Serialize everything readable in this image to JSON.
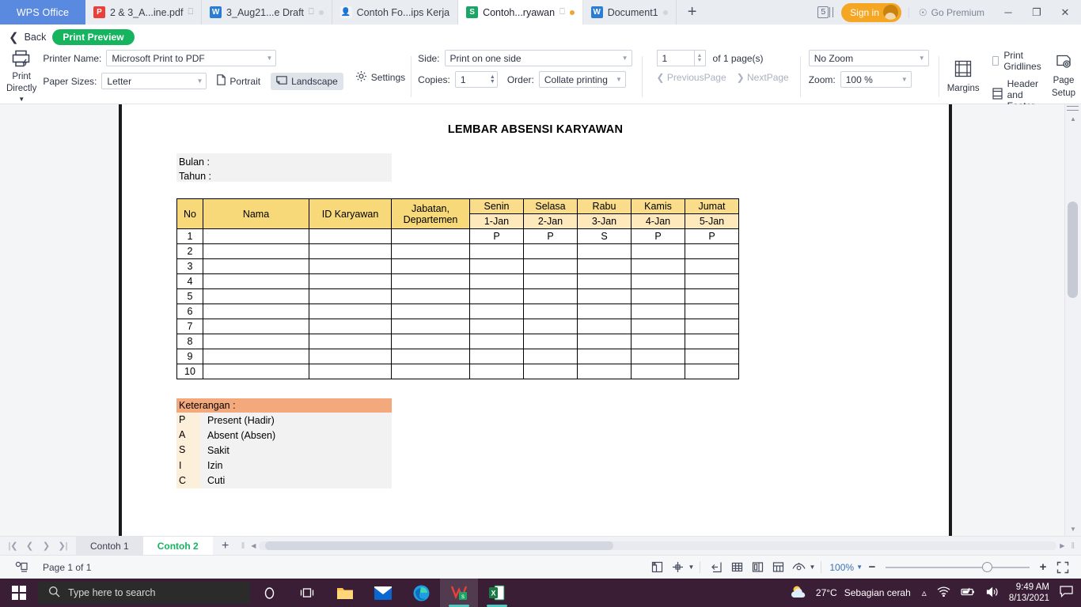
{
  "window": {
    "brand": "WPS Office",
    "tabs": [
      {
        "label": "2 & 3_A...ine.pdf",
        "icon": "pdf-icon",
        "active": false,
        "monitor": true,
        "dot": ""
      },
      {
        "label": "3_Aug21...e Draft",
        "icon": "word-icon",
        "active": false,
        "monitor": true,
        "dot": "gray"
      },
      {
        "label": "Contoh Fo...ips Kerja",
        "icon": "person-icon",
        "active": false,
        "monitor": false,
        "dot": ""
      },
      {
        "label": "Contoh...ryawan",
        "icon": "spreadsheet-icon",
        "active": true,
        "monitor": true,
        "dot": "amber"
      },
      {
        "label": "Document1",
        "icon": "word-icon",
        "active": false,
        "monitor": false,
        "dot": "gray"
      }
    ],
    "new_tab": "+",
    "tab_count": "5",
    "sign_in": "Sign in",
    "go_premium": "Go Premium",
    "minimize": "─",
    "restore": "❐",
    "close": "✕"
  },
  "backbar": {
    "back_label": "Back",
    "mode_label": "Print Preview"
  },
  "ribbon": {
    "print_directly": {
      "line1": "Print",
      "line2": "Directly"
    },
    "printer_name_label": "Printer Name:",
    "printer_name_value": "Microsoft Print to PDF",
    "paper_sizes_label": "Paper Sizes:",
    "paper_sizes_value": "Letter",
    "portrait_label": "Portrait",
    "landscape_label": "Landscape",
    "settings_label": "Settings",
    "side_label": "Side:",
    "side_value": "Print on one side",
    "copies_label": "Copies:",
    "copies_value": "1",
    "order_label": "Order:",
    "order_value": "Collate printing",
    "page_number_value": "1",
    "page_total_label": "of 1 page(s)",
    "previous_page": "PreviousPage",
    "next_page": "NextPage",
    "no_zoom_value": "No Zoom",
    "zoom_label": "Zoom:",
    "zoom_value": "100 %",
    "margins_label": "Margins",
    "print_gridlines_label": "Print Gridlines",
    "header_footer_label": "Header and Footer",
    "page_setup": {
      "line1": "Page",
      "line2": "Setup"
    },
    "clipped_label": "P",
    "overflow": "›"
  },
  "document": {
    "title": "LEMBAR ABSENSI KARYAWAN",
    "info_lines": [
      "Bulan  :",
      "Tahun :"
    ],
    "table": {
      "headers_main": [
        "No",
        "Nama",
        "ID Karyawan",
        "Jabatan, Departemen"
      ],
      "day_names": [
        "Senin",
        "Selasa",
        "Rabu",
        "Kamis",
        "Jumat"
      ],
      "day_dates": [
        "1-Jan",
        "2-Jan",
        "3-Jan",
        "4-Jan",
        "5-Jan"
      ],
      "rows": [
        {
          "no": "1",
          "nama": "",
          "id": "",
          "jabatan": "",
          "marks": [
            "P",
            "P",
            "S",
            "P",
            "P"
          ]
        },
        {
          "no": "2",
          "nama": "",
          "id": "",
          "jabatan": "",
          "marks": [
            "",
            "",
            "",
            "",
            ""
          ]
        },
        {
          "no": "3",
          "nama": "",
          "id": "",
          "jabatan": "",
          "marks": [
            "",
            "",
            "",
            "",
            ""
          ]
        },
        {
          "no": "4",
          "nama": "",
          "id": "",
          "jabatan": "",
          "marks": [
            "",
            "",
            "",
            "",
            ""
          ]
        },
        {
          "no": "5",
          "nama": "",
          "id": "",
          "jabatan": "",
          "marks": [
            "",
            "",
            "",
            "",
            ""
          ]
        },
        {
          "no": "6",
          "nama": "",
          "id": "",
          "jabatan": "",
          "marks": [
            "",
            "",
            "",
            "",
            ""
          ]
        },
        {
          "no": "7",
          "nama": "",
          "id": "",
          "jabatan": "",
          "marks": [
            "",
            "",
            "",
            "",
            ""
          ]
        },
        {
          "no": "8",
          "nama": "",
          "id": "",
          "jabatan": "",
          "marks": [
            "",
            "",
            "",
            "",
            ""
          ]
        },
        {
          "no": "9",
          "nama": "",
          "id": "",
          "jabatan": "",
          "marks": [
            "",
            "",
            "",
            "",
            ""
          ]
        },
        {
          "no": "10",
          "nama": "",
          "id": "",
          "jabatan": "",
          "marks": [
            "",
            "",
            "",
            "",
            ""
          ]
        }
      ]
    },
    "legend": {
      "heading": "Keterangan :",
      "entries": [
        {
          "code": "P",
          "desc": "Present (Hadir)"
        },
        {
          "code": "A",
          "desc": "Absent (Absen)"
        },
        {
          "code": "S",
          "desc": "Sakit"
        },
        {
          "code": "I",
          "desc": "Izin"
        },
        {
          "code": "C",
          "desc": "Cuti"
        }
      ]
    }
  },
  "sheetbar": {
    "tabs": [
      {
        "label": "Contoh 1",
        "active": false
      },
      {
        "label": "Contoh 2",
        "active": true
      }
    ],
    "add_sheet": "+"
  },
  "statusbar": {
    "page_info": "Page 1 of 1",
    "zoom_percent": "100%",
    "minus": "−",
    "plus": "+"
  },
  "taskbar": {
    "search_placeholder": "Type here to search",
    "temperature": "27°C",
    "weather_text": "Sebagian cerah",
    "time": "9:49 AM",
    "date": "8/13/2021"
  },
  "colors": {
    "accent_green": "#16b45f",
    "tab_blue": "#5a8ae0",
    "signin_amber": "#f5a623",
    "table_header_gold": "#f8d979",
    "table_date_gold": "#fde9bc",
    "legend_orange": "#f4a97d",
    "legend_code_bg": "#fdf0db",
    "taskbar_bg": "#3a1e35"
  }
}
